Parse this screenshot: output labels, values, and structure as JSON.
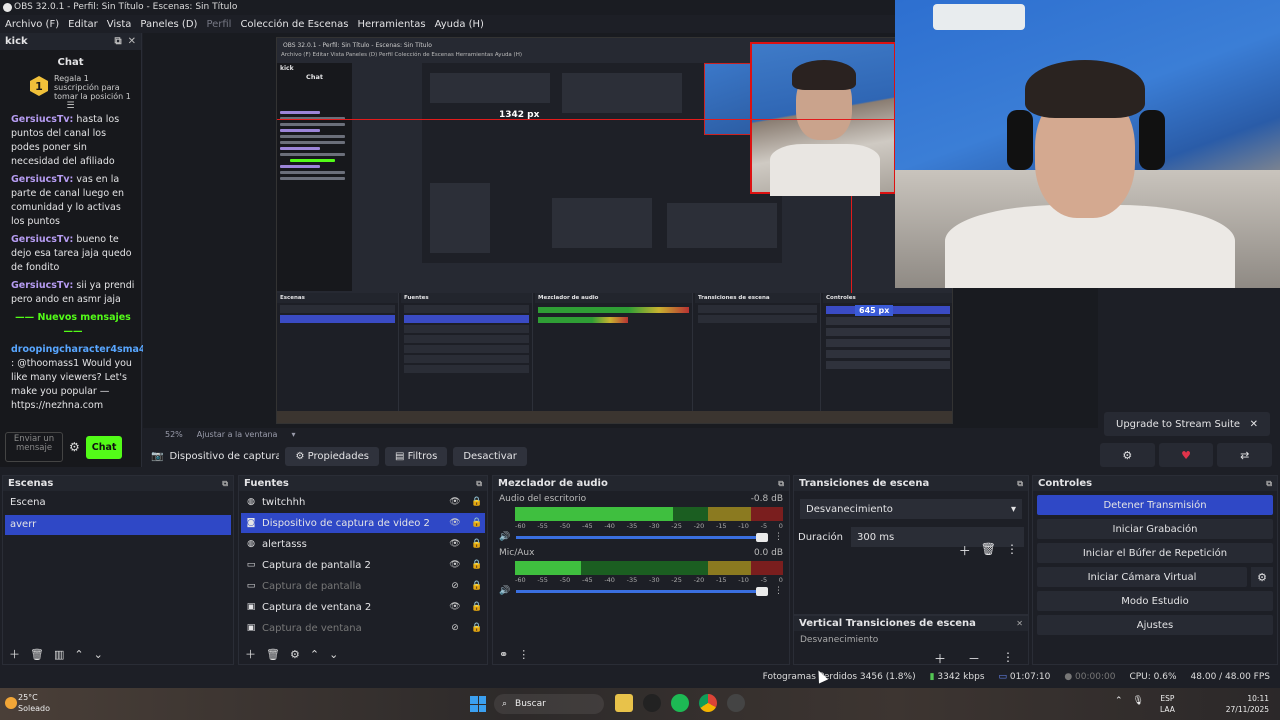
{
  "titlebar": {
    "title": "OBS 32.0.1 - Perfil: Sin Título - Escenas: Sin Título"
  },
  "menu": [
    "Archivo (F)",
    "Editar",
    "Vista",
    "Paneles (D)",
    "Perfil",
    "Colección de Escenas",
    "Herramientas",
    "Ayuda (H)"
  ],
  "chat": {
    "dock_title": "kick",
    "title": "Chat",
    "pinned": "Regala 1 suscripción para tomar la posición 1",
    "pinned_count": "1",
    "messages": [
      {
        "user": "GersiucsTv:",
        "text": "hasta los puntos del canal los podes poner sin necesidad del afiliado"
      },
      {
        "user": "GersiucsTv:",
        "text": "vas en la parte de canal luego en comunidad y lo activas los puntos"
      },
      {
        "user": "GersiucsTv:",
        "text": "bueno te dejo esa tarea jaja quedo de fondito"
      },
      {
        "user": "GersiucsTv:",
        "text": "sii ya prendi pero ando en asmr jaja"
      }
    ],
    "new_messages": "Nuevos mensajes",
    "last": {
      "user": "droopingcharacter4sma4ng",
      "text": ": @thoomass1 Would you like many viewers? Let's make you popular — https://nezhna.com"
    },
    "input_placeholder": "Enviar un mensaje",
    "send_label": "Chat"
  },
  "preview": {
    "px_label_1": "1342 px",
    "px_label_2": "645 px",
    "scale": "52%",
    "fit": "Ajustar a la ventana"
  },
  "upgrade": {
    "label": "Upgrade to Stream Suite"
  },
  "source_toolbar": {
    "name": "Dispositivo de captura de v",
    "props": "Propiedades",
    "filters": "Filtros",
    "deactivate": "Desactivar"
  },
  "scenes": {
    "title": "Escenas",
    "items": [
      "Escena",
      "averr"
    ]
  },
  "sources": {
    "title": "Fuentes",
    "items": [
      {
        "name": "twitchhh",
        "icon": "globe-icon"
      },
      {
        "name": "Dispositivo de captura de video 2",
        "icon": "camera-icon"
      },
      {
        "name": "alertasss",
        "icon": "globe-icon"
      },
      {
        "name": "Captura de pantalla 2",
        "icon": "monitor-icon"
      },
      {
        "name": "Captura de pantalla",
        "icon": "monitor-icon"
      },
      {
        "name": "Captura de ventana 2",
        "icon": "window-icon"
      },
      {
        "name": "Captura de ventana",
        "icon": "window-icon"
      }
    ]
  },
  "mixer": {
    "title": "Mezclador de audio",
    "channels": [
      {
        "name": "Audio del escritorio",
        "db": "-0.8 dB",
        "level": 0.82
      },
      {
        "name": "Mic/Aux",
        "db": "0.0 dB",
        "level": 0.34
      }
    ],
    "ticks": [
      "-60",
      "-55",
      "-50",
      "-45",
      "-40",
      "-35",
      "-30",
      "-25",
      "-20",
      "-15",
      "-10",
      "-5",
      "0"
    ]
  },
  "transitions": {
    "title": "Transiciones de escena",
    "selected": "Desvanecimiento",
    "duration_label": "Duración",
    "duration": "300 ms"
  },
  "vtransitions": {
    "title": "Vertical Transiciones de escena",
    "selected": "Desvanecimiento"
  },
  "controls": {
    "title": "Controles",
    "buttons": [
      "Detener Transmisión",
      "Iniciar Grabación",
      "Iniciar el Búfer de Repetición",
      "Iniciar Cámara Virtual",
      "Modo Estudio",
      "Ajustes"
    ]
  },
  "status": {
    "dropped": "Fotogramas Perdidos 3456 (1.8%)",
    "bitrate": "3342 kbps",
    "live_time": "01:07:10",
    "rec_time": "00:00:00",
    "cpu": "CPU: 0.6%",
    "fps": "48.00 / 48.00 FPS"
  },
  "taskbar": {
    "temp": "25°C",
    "weather": "Soleado",
    "search": "Buscar",
    "lang1": "ESP",
    "lang2": "LAA",
    "time": "10:11",
    "date": "27/11/2025"
  },
  "colors": {
    "accent": "#2f48c6",
    "kick_green": "#53fc18",
    "red_guide": "#e21b1b"
  }
}
